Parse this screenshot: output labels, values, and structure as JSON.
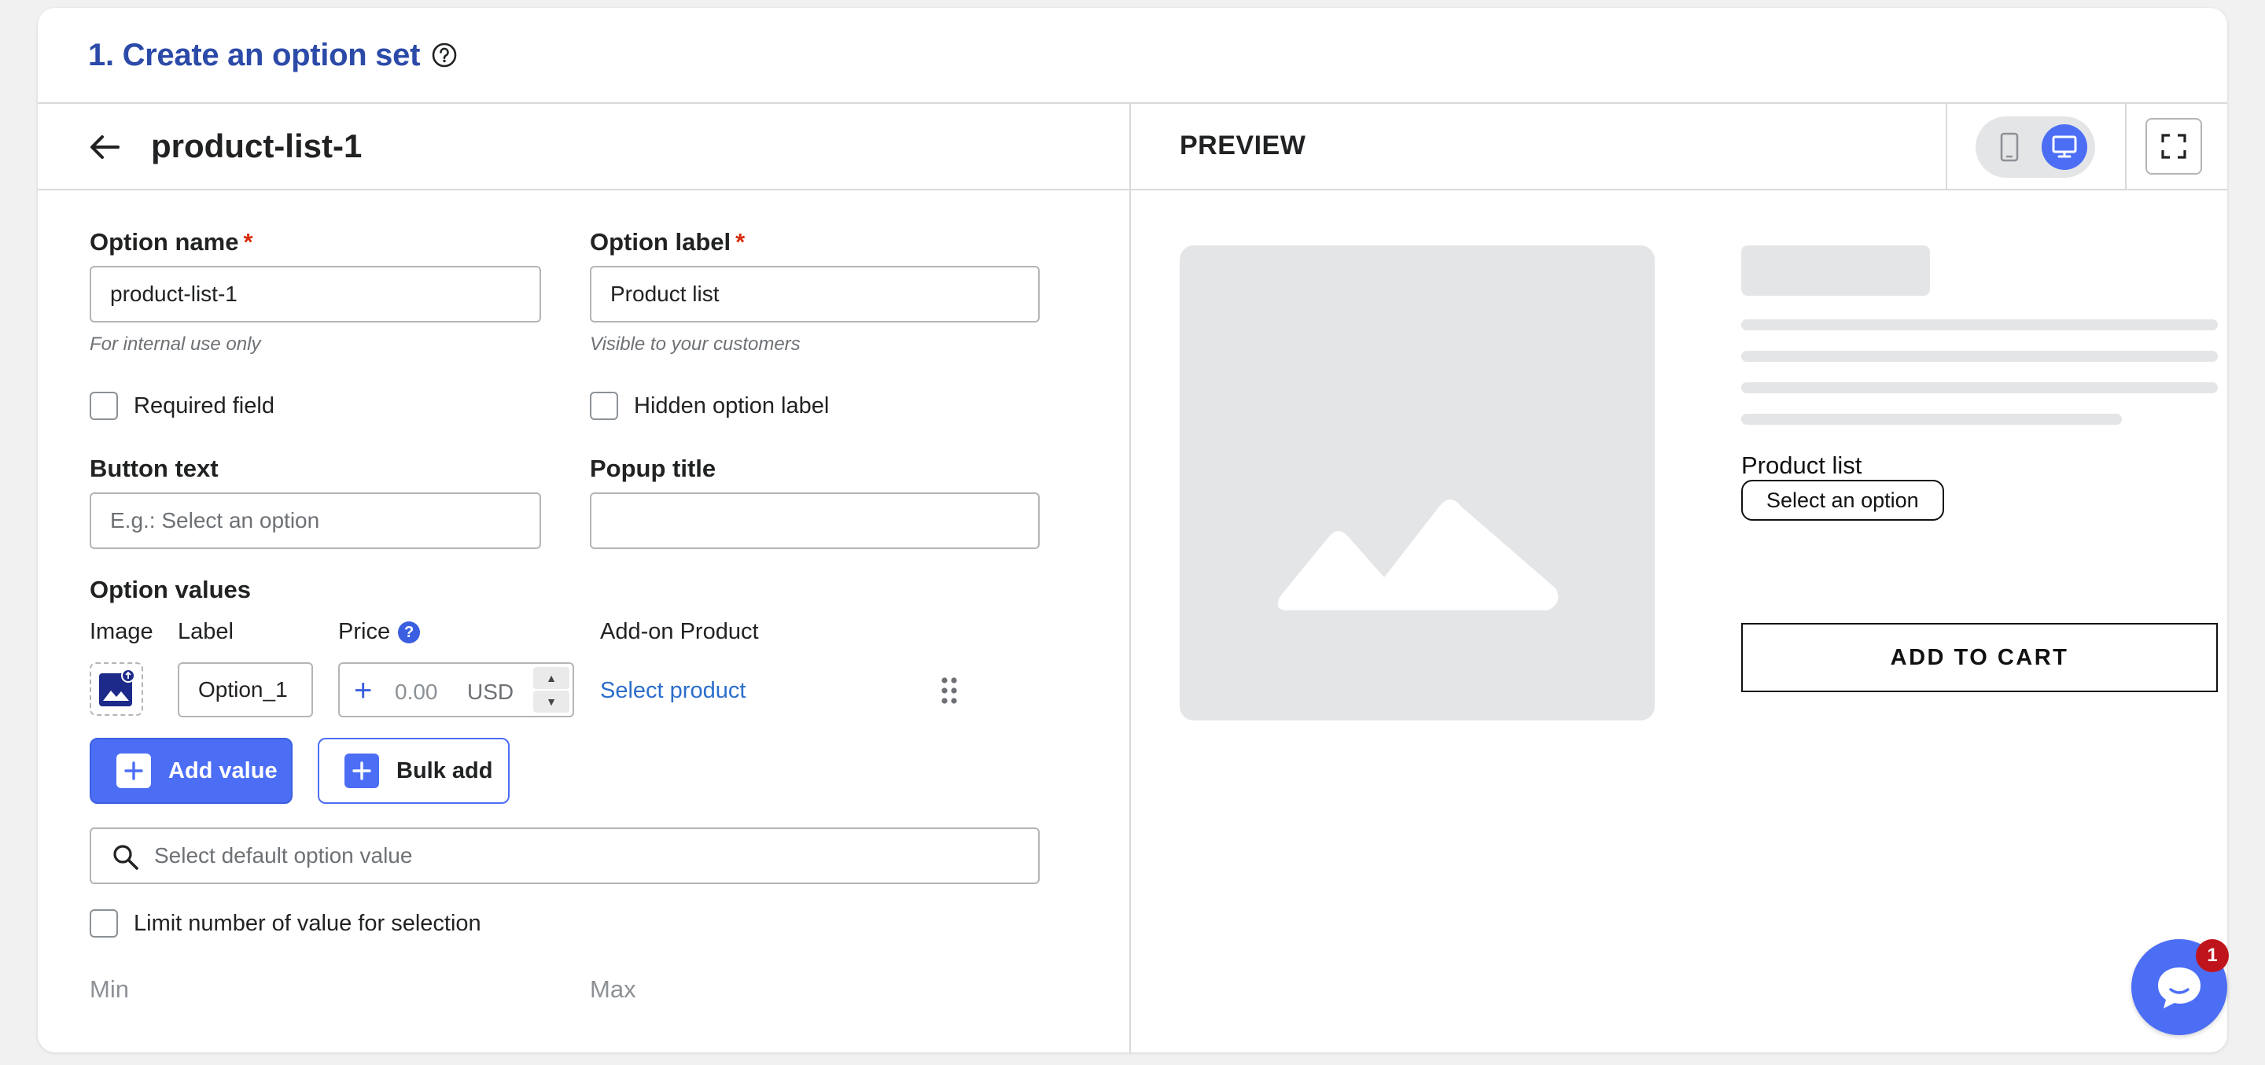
{
  "header": {
    "title": "1. Create an option set"
  },
  "editor": {
    "set_name": "product-list-1",
    "option_name": {
      "label": "Option name",
      "required_mark": "*",
      "value": "product-list-1",
      "hint": "For internal use only"
    },
    "option_label": {
      "label": "Option label",
      "required_mark": "*",
      "value": "Product list",
      "hint": "Visible to your customers"
    },
    "required_field": "Required field",
    "hidden_option_label": "Hidden option label",
    "button_text": {
      "label": "Button text",
      "placeholder": "E.g.: Select an option",
      "value": ""
    },
    "popup_title": {
      "label": "Popup title",
      "value": ""
    },
    "option_values": {
      "heading": "Option values",
      "columns": {
        "image": "Image",
        "label": "Label",
        "price": "Price",
        "price_help": "?",
        "addon": "Add-on Product"
      },
      "row": {
        "label": "Option_1",
        "price_placeholder": "0.00",
        "currency": "USD",
        "select_product": "Select product"
      },
      "add_value": "Add value",
      "bulk_add": "Bulk add"
    },
    "default_search_placeholder": "Select default option value",
    "limit_label": "Limit number of value for selection",
    "min_label": "Min",
    "max_label": "Max"
  },
  "preview": {
    "title": "PREVIEW",
    "product_label": "Product list",
    "select_button": "Select an option",
    "add_to_cart": "ADD TO CART"
  },
  "chat": {
    "badge": "1"
  },
  "colors": {
    "accent": "#4c6ef5",
    "title_blue": "#2c4aa8",
    "link": "#2c6ecb",
    "required": "#d72c0d",
    "badge": "#c0141c"
  }
}
